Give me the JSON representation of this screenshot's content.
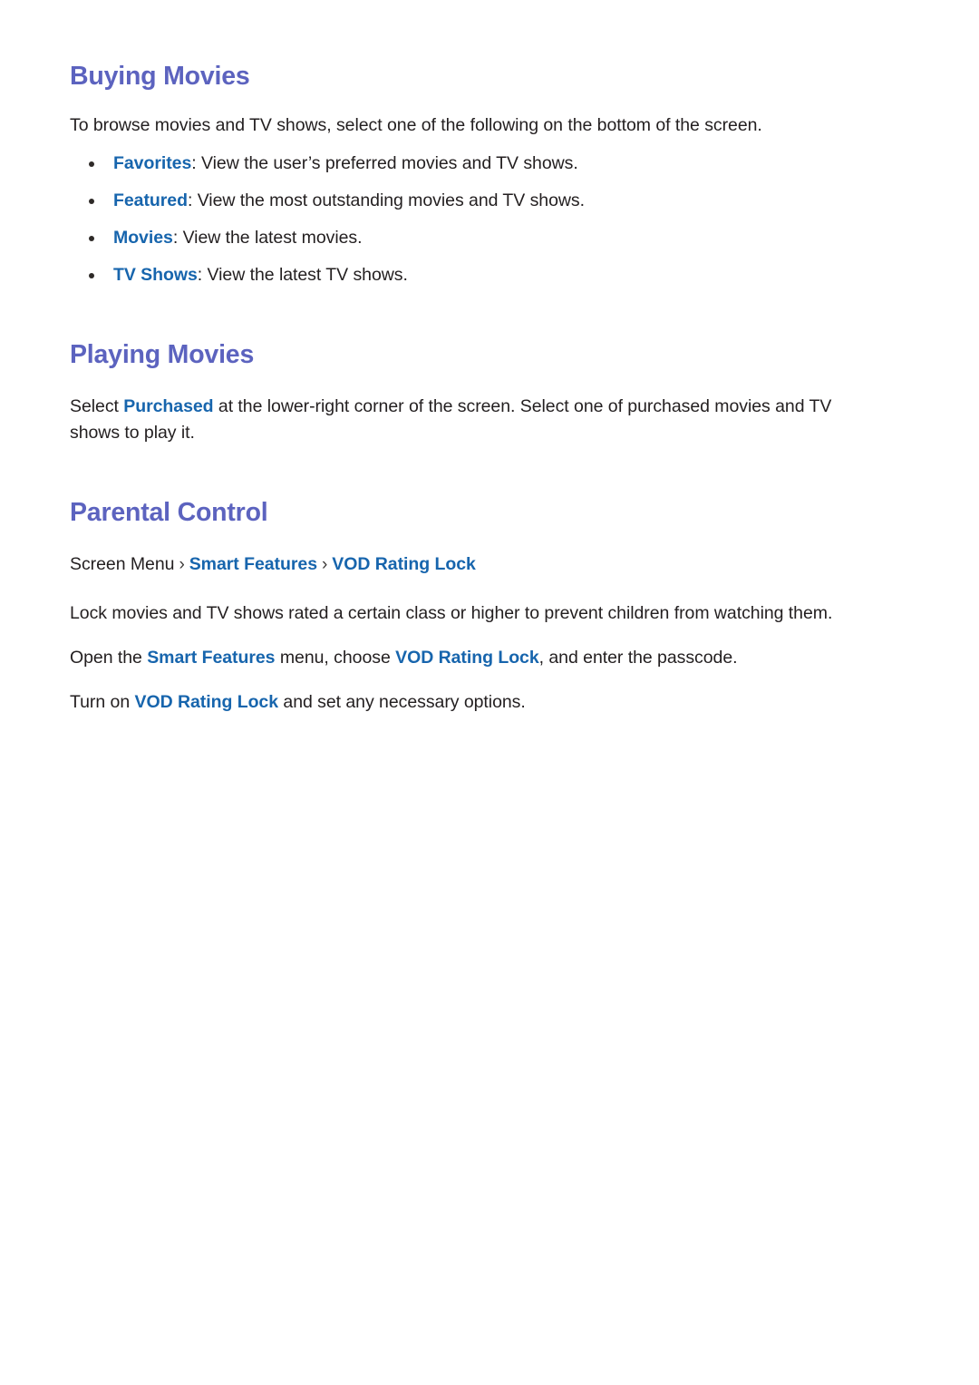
{
  "document": {
    "sections": [
      {
        "id": "buying",
        "heading": "Buying Movies",
        "intro": "To browse movies and TV shows, select one of the following on the bottom of the screen.",
        "bullets": [
          {
            "label": "Favorites",
            "separator": ":",
            "description": "View the user’s preferred movies and TV shows."
          },
          {
            "label": "Featured",
            "separator": ":",
            "description": "View the most outstanding movies and TV shows."
          },
          {
            "label": "Movies",
            "separator": ":",
            "description": "View the latest movies."
          },
          {
            "label": "TV Shows",
            "separator": ":",
            "description": "View the latest TV shows."
          }
        ]
      },
      {
        "id": "playing",
        "heading": "Playing Movies",
        "paragraph": {
          "part1": "Select ",
          "link1": "Purchased",
          "part2": " at the lower-right corner of the screen. Select one of purchased movies and TV shows to play it."
        }
      },
      {
        "id": "parental",
        "heading": "Parental Control",
        "breadcrumb": {
          "root": "Screen Menu",
          "separator": "›",
          "level2": "Smart Features",
          "level3": "VOD Rating Lock"
        },
        "line1": "Lock movies and TV shows rated a certain class or higher to prevent children from watching them.",
        "line2": {
          "part1": "Open the ",
          "link1": "Smart Features",
          "part2": " menu, choose ",
          "link2": "VOD Rating Lock",
          "part3": ", and enter the passcode."
        },
        "line3": {
          "part1": "Turn on ",
          "link1": "VOD Rating Lock",
          "part2": " and set any necessary options."
        }
      }
    ]
  },
  "colors": {
    "heading": "#5c63bf",
    "link": "#1765ad",
    "body": "#231f20",
    "background": "#ffffff"
  }
}
